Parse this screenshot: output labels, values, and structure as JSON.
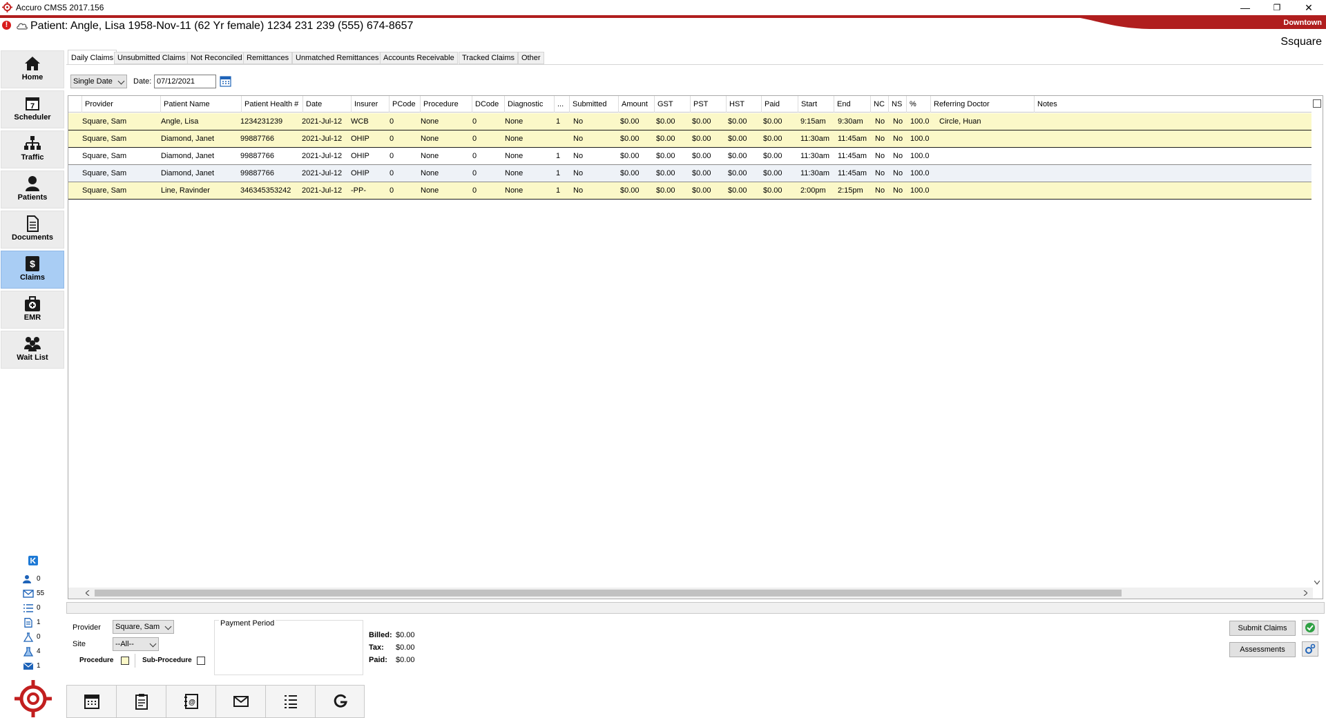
{
  "window": {
    "title": "Accuro CMS5 2017.156",
    "location": "Downtown",
    "minimize_glyph": "—",
    "restore_glyph": "❐",
    "close_glyph": "✕"
  },
  "banner": {
    "patient_text": "Patient: Angle, Lisa 1958-Nov-11 (62 Yr female) 1234 231 239 (555) 674-8657",
    "alert_glyph": "!",
    "user": "Ssquare"
  },
  "nav": {
    "items": [
      {
        "label": "Home",
        "icon": "home-icon"
      },
      {
        "label": "Scheduler",
        "icon": "calendar-icon"
      },
      {
        "label": "Traffic",
        "icon": "hierarchy-icon"
      },
      {
        "label": "Patients",
        "icon": "person-icon"
      },
      {
        "label": "Documents",
        "icon": "document-icon"
      },
      {
        "label": "Claims",
        "icon": "dollar-icon",
        "active": true
      },
      {
        "label": "EMR",
        "icon": "medical-bag-icon"
      },
      {
        "label": "Wait List",
        "icon": "people-icon"
      }
    ]
  },
  "counters": [
    {
      "icon": "users-icon",
      "value": "0"
    },
    {
      "icon": "mail-icon",
      "value": "55"
    },
    {
      "icon": "list-icon",
      "value": "0"
    },
    {
      "icon": "doc-icon",
      "value": "1"
    },
    {
      "icon": "flask-icon",
      "value": "0"
    },
    {
      "icon": "lab-icon",
      "value": "4"
    },
    {
      "icon": "inbox-icon",
      "value": "1"
    }
  ],
  "tabs": [
    {
      "label": "Daily Claims",
      "active": true
    },
    {
      "label": "Unsubmitted Claims"
    },
    {
      "label": "Not Reconciled"
    },
    {
      "label": "Remittances"
    },
    {
      "label": "Unmatched Remittances"
    },
    {
      "label": "Accounts Receivable"
    },
    {
      "label": "Tracked Claims"
    },
    {
      "label": "Other"
    }
  ],
  "filter": {
    "date_mode": "Single Date",
    "date_label": "Date:",
    "date_value": "07/12/2021"
  },
  "table": {
    "columns": [
      "Provider",
      "Patient Name",
      "Patient Health #",
      "Date",
      "Insurer",
      "PCode",
      "Procedure",
      "DCode",
      "Diagnostic",
      "...",
      "Submitted",
      "Amount",
      "GST",
      "PST",
      "HST",
      "Paid",
      "Start",
      "End",
      "NC",
      "NS",
      "%",
      "Referring Doctor",
      "Notes"
    ],
    "rows": [
      {
        "style": "yellow",
        "cells": [
          "Square, Sam",
          "Angle, Lisa",
          "1234231239",
          "2021-Jul-12",
          "WCB",
          "0",
          "None",
          "0",
          "None",
          "1",
          "No",
          "$0.00",
          "$0.00",
          "$0.00",
          "$0.00",
          "$0.00",
          "9:15am",
          "9:30am",
          "No",
          "No",
          "100.0",
          "Circle, Huan",
          ""
        ]
      },
      {
        "style": "yellow",
        "cells": [
          "Square, Sam",
          "Diamond, Janet",
          "99887766",
          "2021-Jul-12",
          "OHIP",
          "0",
          "None",
          "0",
          "None",
          "",
          "No",
          "$0.00",
          "$0.00",
          "$0.00",
          "$0.00",
          "$0.00",
          "11:30am",
          "11:45am",
          "No",
          "No",
          "100.0",
          "",
          ""
        ]
      },
      {
        "style": "white",
        "cells": [
          "Square, Sam",
          "Diamond, Janet",
          "99887766",
          "2021-Jul-12",
          "OHIP",
          "0",
          "None",
          "0",
          "None",
          "1",
          "No",
          "$0.00",
          "$0.00",
          "$0.00",
          "$0.00",
          "$0.00",
          "11:30am",
          "11:45am",
          "No",
          "No",
          "100.0",
          "",
          ""
        ]
      },
      {
        "style": "blue",
        "cells": [
          "Square, Sam",
          "Diamond, Janet",
          "99887766",
          "2021-Jul-12",
          "OHIP",
          "0",
          "None",
          "0",
          "None",
          "1",
          "No",
          "$0.00",
          "$0.00",
          "$0.00",
          "$0.00",
          "$0.00",
          "11:30am",
          "11:45am",
          "No",
          "No",
          "100.0",
          "",
          ""
        ]
      },
      {
        "style": "yellow",
        "cells": [
          "Square, Sam",
          "Line, Ravinder",
          "346345353242",
          "2021-Jul-12",
          "-PP-",
          "0",
          "None",
          "0",
          "None",
          "1",
          "No",
          "$0.00",
          "$0.00",
          "$0.00",
          "$0.00",
          "$0.00",
          "2:00pm",
          "2:15pm",
          "No",
          "No",
          "100.0",
          "",
          ""
        ]
      }
    ]
  },
  "bottom": {
    "provider_label": "Provider",
    "provider_value": "Square, Sam",
    "site_label": "Site",
    "site_value": "--All--",
    "procedure_label": "Procedure",
    "subprocedure_label": "Sub-Procedure",
    "payment_period_label": "Payment Period",
    "billed_label": "Billed:",
    "billed_value": "$0.00",
    "tax_label": "Tax:",
    "tax_value": "$0.00",
    "paid_label": "Paid:",
    "paid_value": "$0.00",
    "submit_button": "Submit Claims",
    "assessments_button": "Assessments"
  },
  "toolbar": {
    "items": [
      "calendar-grid-icon",
      "clipboard-icon",
      "address-book-icon",
      "envelope-icon",
      "checklist-icon",
      "refresh-g-icon"
    ]
  },
  "colors": {
    "accent_red": "#b01e1e",
    "row_yellow": "#fbf8c8",
    "row_blue": "#eef2f7",
    "nav_active": "#a9cdf4"
  }
}
